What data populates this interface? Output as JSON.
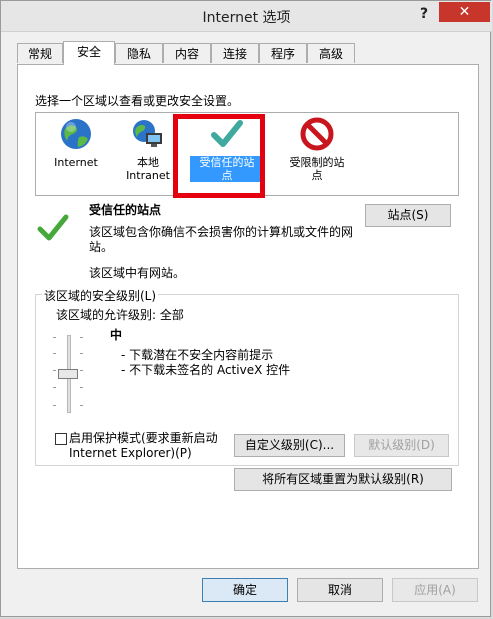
{
  "window": {
    "title": "Internet 选项",
    "help": "?",
    "close": "✕"
  },
  "tabs": [
    "常规",
    "安全",
    "隐私",
    "内容",
    "连接",
    "程序",
    "高级"
  ],
  "security": {
    "instruction": "选择一个区域以查看或更改安全设置。",
    "zones": [
      {
        "label": "Internet",
        "icon": "globe-icon"
      },
      {
        "label": "本地\nIntranet",
        "icon": "intranet-icon"
      },
      {
        "label": "受信任的站\n点",
        "icon": "checkmark-icon"
      },
      {
        "label": "受限制的站\n点",
        "icon": "restricted-icon"
      }
    ],
    "selected_zone": {
      "name": "受信任的站点",
      "description": "该区域包含你确信不会损害你的计算机或文件的网站。",
      "status": "该区域中有网站。",
      "sites_button": "站点(S)"
    },
    "level_group": {
      "title": "该区域的安全级别(L)",
      "allowed": "该区域的允许级别: 全部",
      "level_name": "中",
      "bullets": [
        "- 下载潜在不安全内容前提示",
        "- 不下载未签名的 ActiveX 控件"
      ],
      "level_value": 0.5
    },
    "protected_mode": {
      "label": "启用保护模式(要求重新启动\nInternet Explorer)(P)",
      "checked": false
    },
    "custom_button": "自定义级别(C)...",
    "default_button": "默认级别(D)",
    "reset_all_button": "将所有区域重置为默认级别(R)"
  },
  "footer": {
    "ok": "确定",
    "cancel": "取消",
    "apply": "应用(A)"
  },
  "colors": {
    "selection": "#3399ff",
    "highlight_frame": "#e4000f",
    "close": "#c8352b"
  }
}
